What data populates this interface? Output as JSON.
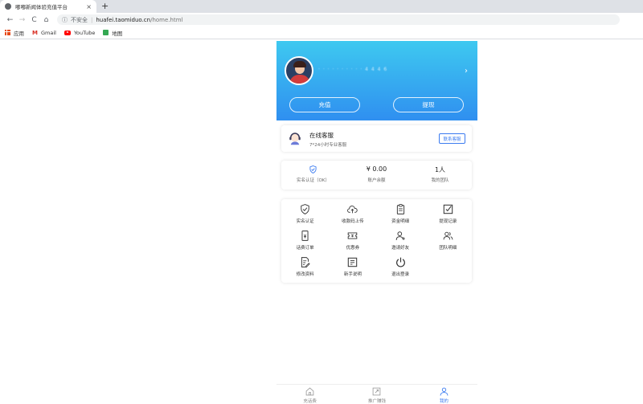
{
  "browser": {
    "tab_title": "嘟嘟新闻体验充值平台",
    "tab_close": "×",
    "new_tab": "+",
    "nav_back": "←",
    "nav_forward": "→",
    "nav_reload": "C",
    "nav_home": "⌂",
    "security_icon": "ⓘ",
    "security_label": "不安全",
    "separator": "|",
    "url_host": "huafei.taomiduo.cn",
    "url_path": "/home.html",
    "bookmarks": [
      {
        "label": "应用",
        "icon": "apps-icon"
      },
      {
        "label": "Gmail",
        "icon": "gmail-icon"
      },
      {
        "label": "YouTube",
        "icon": "youtube-icon"
      },
      {
        "label": "地图",
        "icon": "maps-icon"
      }
    ],
    "gmail_glyph": "M"
  },
  "profile": {
    "username": "· · · · · · · · · · 4 4 4 6",
    "arrow": "›",
    "recharge_label": "充值",
    "withdraw_label": "提现"
  },
  "service": {
    "title": "在线客服",
    "subtitle": "7*24小时专业客服",
    "button_label": "联系客服"
  },
  "stats": [
    {
      "value": "",
      "label": "实名认证（OK）"
    },
    {
      "value": "¥ 0.00",
      "label": "账户余额"
    },
    {
      "value": "1人",
      "label": "我的团队"
    }
  ],
  "menu": [
    {
      "label": "实名认证",
      "icon": "shield-check-icon"
    },
    {
      "label": "收款码上传",
      "icon": "cloud-upload-icon"
    },
    {
      "label": "资金明细",
      "icon": "clipboard-icon"
    },
    {
      "label": "提现记录",
      "icon": "checkbox-icon"
    },
    {
      "label": "话费订单",
      "icon": "phone-order-icon"
    },
    {
      "label": "优惠券",
      "icon": "coupon-icon"
    },
    {
      "label": "邀请好友",
      "icon": "add-user-icon"
    },
    {
      "label": "团队明细",
      "icon": "team-icon"
    },
    {
      "label": "修改资料",
      "icon": "edit-doc-icon"
    },
    {
      "label": "新手说明",
      "icon": "guide-icon"
    },
    {
      "label": "退出登录",
      "icon": "power-icon"
    }
  ],
  "tabbar": [
    {
      "label": "充话费",
      "icon": "home-icon",
      "active": false
    },
    {
      "label": "推广赚钱",
      "icon": "share-icon",
      "active": false
    },
    {
      "label": "我的",
      "icon": "user-icon",
      "active": true
    }
  ],
  "colors": {
    "accent": "#3b7bf0",
    "header_gradient_top": "#3ec9f0",
    "header_gradient_bottom": "#2f8ff0"
  }
}
